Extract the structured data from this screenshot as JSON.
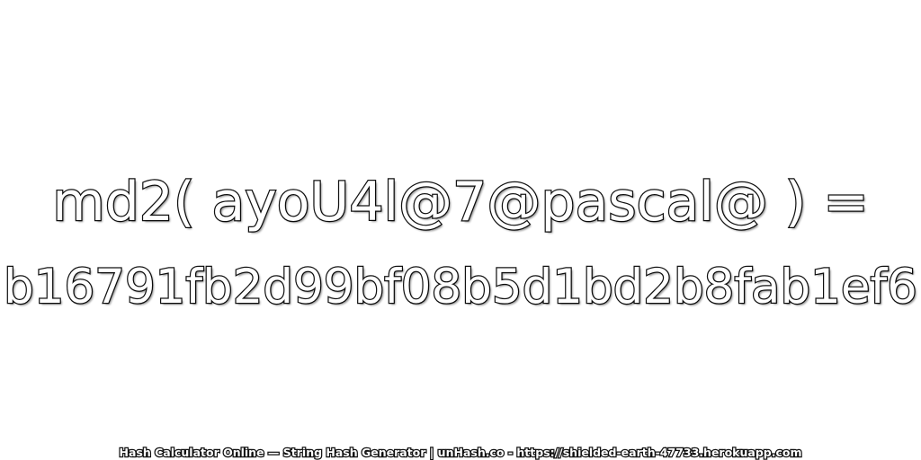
{
  "heading": {
    "expression": "md2( ayoU4l@7@pascal@ ) =",
    "hash": "b16791fb2d99bf08b5d1bd2b8fab1ef6"
  },
  "footer": {
    "text": "Hash Calculator Online — String Hash Generator | unHash.co - https://shielded-earth-47733.herokuapp.com"
  },
  "colors": {
    "background": "#ffffff",
    "text_fill": "#ffffff",
    "text_outline": "#111111"
  }
}
